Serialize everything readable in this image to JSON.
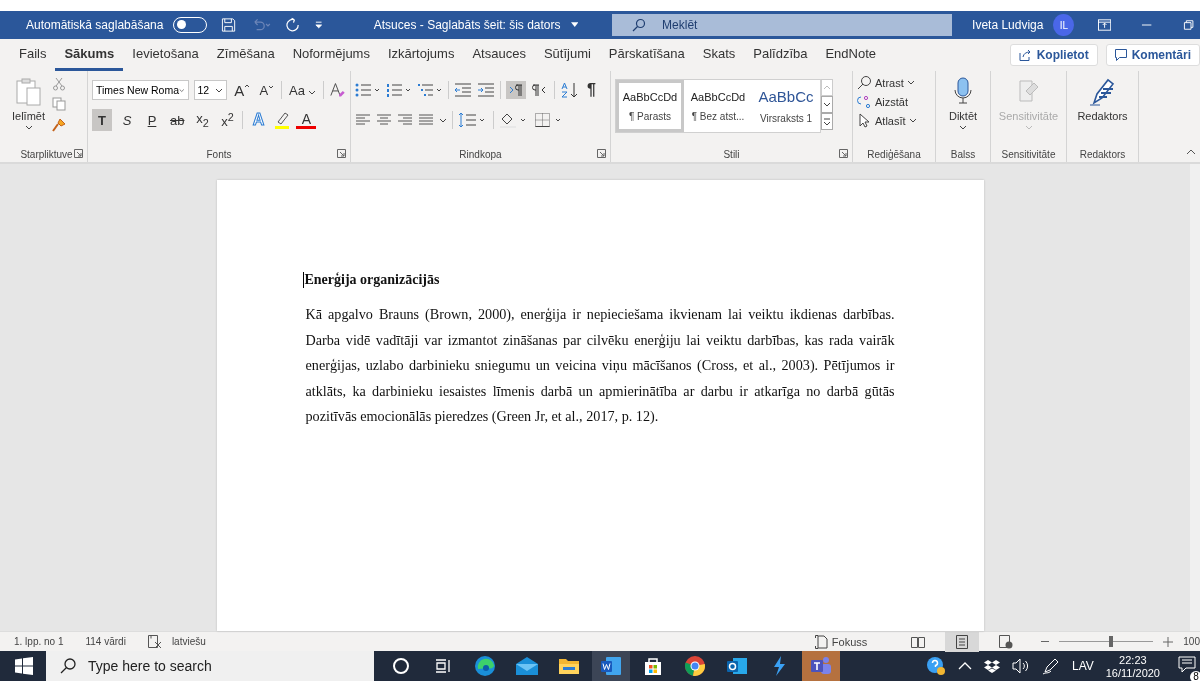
{
  "title_bar": {
    "autosave_label": "Automātiskā saglabāšana",
    "autosave_on": false,
    "doc_title": "Atsuces  -  Saglabāts šeit: šis dators",
    "search_placeholder": "Meklēt",
    "user_name": "Iveta Ludviga",
    "user_initials": "IL"
  },
  "tabs": [
    {
      "label": "Fails",
      "selected": false
    },
    {
      "label": "Sākums",
      "selected": true
    },
    {
      "label": "Ievietošana",
      "selected": false
    },
    {
      "label": "Zīmēšana",
      "selected": false
    },
    {
      "label": "Noformējums",
      "selected": false
    },
    {
      "label": "Izkārtojums",
      "selected": false
    },
    {
      "label": "Atsauces",
      "selected": false
    },
    {
      "label": "Sūtījumi",
      "selected": false
    },
    {
      "label": "Pārskatīšana",
      "selected": false
    },
    {
      "label": "Skats",
      "selected": false
    },
    {
      "label": "Palīdzība",
      "selected": false
    },
    {
      "label": "EndNote",
      "selected": false
    }
  ],
  "share_button": "Koplietot",
  "comments_button": "Komentāri",
  "ribbon": {
    "clipboard": {
      "paste_label": "Ielīmēt",
      "group_label": "Starpliktuve"
    },
    "font": {
      "font_name": "Times New Roma",
      "font_size": "12",
      "grow": "A",
      "shrink": "A",
      "case": "Aa",
      "format_buttons": [
        {
          "kind": "bold",
          "label": "T",
          "selected": true
        },
        {
          "kind": "italic",
          "label": "S",
          "selected": false
        },
        {
          "kind": "underline",
          "label": "P",
          "selected": false
        },
        {
          "kind": "strike",
          "label": "ab",
          "selected": false
        },
        {
          "kind": "sub",
          "label": "x$_{2}$",
          "selected": false
        },
        {
          "kind": "sup",
          "label": "x$^{2}$",
          "selected": false
        }
      ],
      "effects": "A",
      "font_color": "A",
      "group_label": "Fonts"
    },
    "paragraph": {
      "show_marks": "¶",
      "group_label": "Rindkopa"
    },
    "styles": {
      "items": [
        {
          "preview": "AaBbCcDd",
          "name": "¶ Parasts",
          "kind": "normal",
          "selected": true
        },
        {
          "preview": "AaBbCcDd",
          "name": "¶ Bez atst...",
          "kind": "normal",
          "selected": false
        },
        {
          "preview": "AaBbCc",
          "name": "Virsraksts 1",
          "kind": "heading",
          "selected": false
        }
      ],
      "group_label": "Stili"
    },
    "editing": {
      "items": [
        "Atrast",
        "Aizstāt",
        "Atlasīt"
      ],
      "group_label": "Rediģēšana"
    },
    "voice": {
      "label": "Diktēt",
      "group_label": "Balss"
    },
    "sensitivity": {
      "label": "Sensitivitāte",
      "disabled": true,
      "group_label": "Sensitivitāte"
    },
    "editor": {
      "label": "Redaktors",
      "group_label": "Redaktors"
    }
  },
  "document": {
    "heading": "Enerģija organizācijās",
    "paragraph": "Kā apgalvo Brauns (Brown, 2000), enerģija ir nepieciešama ikvienam lai veiktu ikdienas darbības. Darba vidē vadītāji var izmantot zināšanas par cilvēku enerģiju lai  veiktu darbības, kas rada vairāk enerģijas, uzlabo darbinieku sniegumu un veicina viņu mācīšanos (Cross, et al., 2003). Pētījumos ir atklāts, ka darbinieku iesaistes līmenis darbā un apmierinātība ar darbu ir atkarīga no darbā gūtās pozitīvās emocionālās pieredzes (Green Jr, et al., 2017, p. 12)."
  },
  "status_bar": {
    "page": "1. lpp. no 1",
    "words": "114 vārdi",
    "language": "latviešu",
    "focus": "Fokuss",
    "views": [
      {
        "kind": "read",
        "selected": false
      },
      {
        "kind": "print",
        "selected": true
      },
      {
        "kind": "web",
        "selected": false
      }
    ],
    "zoom": {
      "level": 0.55
    },
    "zoom_text": "100"
  },
  "taskbar": {
    "search_placeholder": "Type here to search",
    "apps": [
      {
        "kind": "cortana",
        "active": false
      },
      {
        "kind": "taskview",
        "active": false
      },
      {
        "kind": "edge",
        "active": false
      },
      {
        "kind": "mail",
        "active": false
      },
      {
        "kind": "explorer",
        "active": false
      },
      {
        "kind": "word",
        "active": true
      },
      {
        "kind": "store",
        "active": false
      },
      {
        "kind": "chrome",
        "active": false
      },
      {
        "kind": "outlook",
        "active": false
      },
      {
        "kind": "bolt",
        "active": false
      },
      {
        "kind": "teams",
        "active": true
      }
    ],
    "language": "LAV",
    "time": "22:23",
    "date": "16/11/2020",
    "notifications": "8"
  }
}
